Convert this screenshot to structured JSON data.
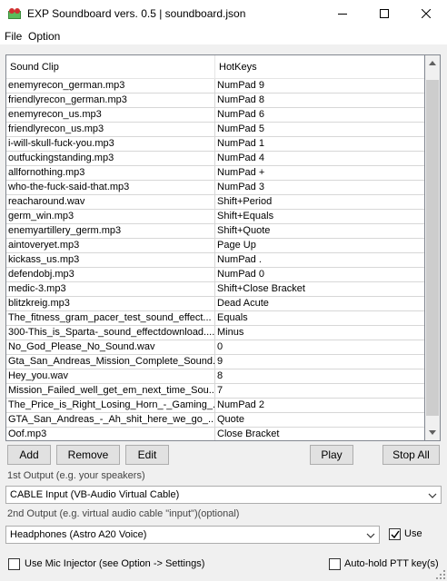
{
  "window": {
    "title": "EXP Soundboard vers. 0.5 | soundboard.json",
    "icon": "app-icon"
  },
  "menu": {
    "file": "File",
    "option": "Option"
  },
  "table": {
    "headers": {
      "clip": "Sound Clip",
      "hotkey": "HotKeys"
    },
    "rows": [
      {
        "clip": "enemyrecon_german.mp3",
        "hotkey": "NumPad 9"
      },
      {
        "clip": "friendlyrecon_german.mp3",
        "hotkey": "NumPad 8"
      },
      {
        "clip": "enemyrecon_us.mp3",
        "hotkey": "NumPad 6"
      },
      {
        "clip": "friendlyrecon_us.mp3",
        "hotkey": "NumPad 5"
      },
      {
        "clip": "i-will-skull-fuck-you.mp3",
        "hotkey": "NumPad 1"
      },
      {
        "clip": "outfuckingstanding.mp3",
        "hotkey": "NumPad 4"
      },
      {
        "clip": "allfornothing.mp3",
        "hotkey": "NumPad +"
      },
      {
        "clip": "who-the-fuck-said-that.mp3",
        "hotkey": "NumPad 3"
      },
      {
        "clip": "reacharound.wav",
        "hotkey": "Shift+Period"
      },
      {
        "clip": "germ_win.mp3",
        "hotkey": "Shift+Equals"
      },
      {
        "clip": "enemyartillery_germ.mp3",
        "hotkey": "Shift+Quote"
      },
      {
        "clip": "aintoveryet.mp3",
        "hotkey": "Page Up"
      },
      {
        "clip": "kickass_us.mp3",
        "hotkey": "NumPad ."
      },
      {
        "clip": "defendobj.mp3",
        "hotkey": "NumPad 0"
      },
      {
        "clip": "medic-3.mp3",
        "hotkey": "Shift+Close Bracket"
      },
      {
        "clip": "blitzkreig.mp3",
        "hotkey": "Dead Acute"
      },
      {
        "clip": "The_fitness_gram_pacer_test_sound_effect...",
        "hotkey": "Equals"
      },
      {
        "clip": "300-This_is_Sparta-_sound_effectdownload....",
        "hotkey": "Minus"
      },
      {
        "clip": "No_God_Please_No_Sound.wav",
        "hotkey": "0"
      },
      {
        "clip": "Gta_San_Andreas_Mission_Complete_Sound...",
        "hotkey": "9"
      },
      {
        "clip": "Hey_you.wav",
        "hotkey": "8"
      },
      {
        "clip": "Mission_Failed_well_get_em_next_time_Sou...",
        "hotkey": "7"
      },
      {
        "clip": "The_Price_is_Right_Losing_Horn_-_Gaming_...",
        "hotkey": "NumPad 2"
      },
      {
        "clip": "GTA_San_Andreas_-_Ah_shit_here_we_go_...",
        "hotkey": "Quote"
      },
      {
        "clip": "Oof.mp3",
        "hotkey": "Close Bracket"
      }
    ]
  },
  "buttons": {
    "add": "Add",
    "remove": "Remove",
    "edit": "Edit",
    "play": "Play",
    "stop_all": "Stop All"
  },
  "output1": {
    "label": "1st Output (e.g. your speakers)",
    "selected": "CABLE Input (VB-Audio Virtual Cable)"
  },
  "output2": {
    "label": "2nd Output (e.g. virtual audio cable \"input\")(optional)",
    "selected": "Headphones (Astro A20 Voice)",
    "use_label": "Use",
    "use_checked": true
  },
  "options": {
    "mic_injector_label": "Use Mic Injector (see Option -> Settings)",
    "mic_injector_checked": false,
    "auto_ptt_label": "Auto-hold PTT key(s)",
    "auto_ptt_checked": false
  }
}
